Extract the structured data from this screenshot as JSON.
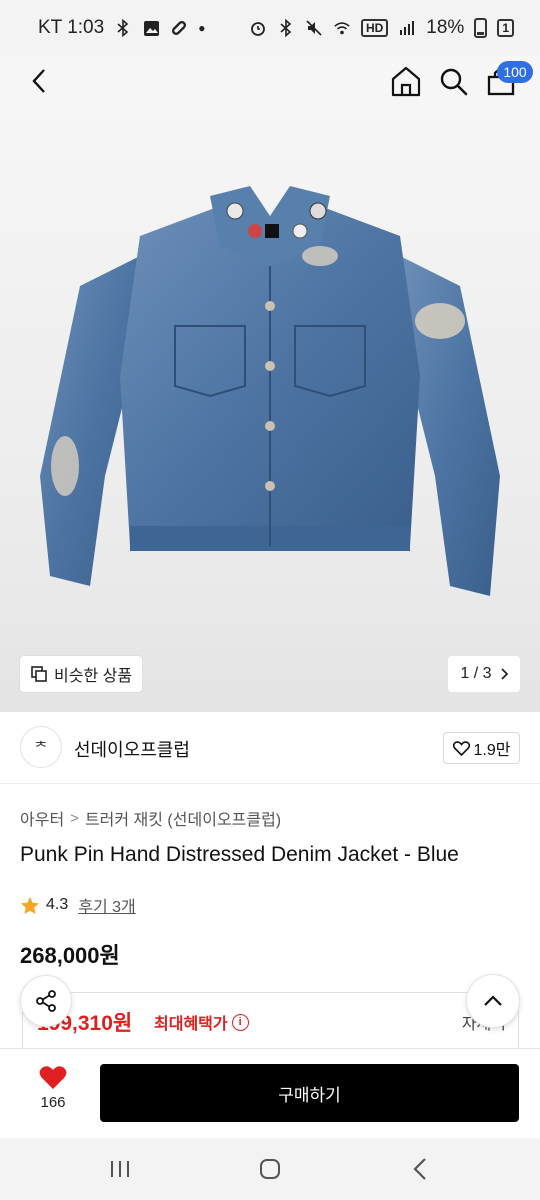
{
  "status_bar": {
    "carrier_time": "KT 1:03",
    "hd_badge": "HD",
    "battery_percent": "18%",
    "sim_badge": "1",
    "icons": [
      "bluetooth-icon",
      "gallery-icon",
      "link-icon",
      "alarm-icon",
      "bluetooth-icon",
      "mute-icon",
      "wifi-icon",
      "signal-icon",
      "battery-icon"
    ]
  },
  "header": {
    "cart_count": "100"
  },
  "gallery": {
    "similar_label": "비슷한 상품",
    "page_indicator": "1 / 3"
  },
  "brand": {
    "logo_text": "ᄎ",
    "name": "선데이오프클럽",
    "likes": "1.9만"
  },
  "product": {
    "breadcrumb": [
      "아우터",
      "트러커 재킷 (선데이오프클럽)"
    ],
    "title": "Punk Pin Hand Distressed Denim Jacket - Blue",
    "rating": "4.3",
    "reviews": "후기 3개",
    "price": "268,000원",
    "benefit_price": "199,310원",
    "benefit_label": "최대혜택가",
    "benefit_detail": "자세히"
  },
  "action_bar": {
    "wish_count": "166",
    "buy_label": "구매하기"
  },
  "colors": {
    "accent_red": "#e02020",
    "badge_blue": "#2f6fe4",
    "buy_black": "#000000"
  }
}
